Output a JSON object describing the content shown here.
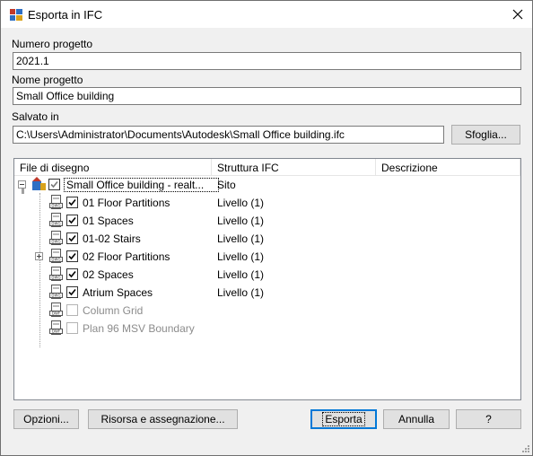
{
  "window": {
    "title": "Esporta in IFC"
  },
  "fields": {
    "project_number_label": "Numero progetto",
    "project_number_value": "2021.1",
    "project_name_label": "Nome progetto",
    "project_name_value": "Small Office building",
    "saved_in_label": "Salvato in",
    "saved_in_value": "C:\\Users\\Administrator\\Documents\\Autodesk\\Small Office building.ifc",
    "browse_label": "Sfoglia..."
  },
  "table": {
    "columns": [
      "File di disegno",
      "Struttura IFC",
      "Descrizione"
    ],
    "rows": [
      {
        "name": "Small Office building - realt...",
        "structure": "Sito",
        "enabled": true,
        "checked": true
      },
      {
        "name": "01 Floor Partitions",
        "structure": "Livello (1)",
        "enabled": true,
        "checked": true
      },
      {
        "name": "01 Spaces",
        "structure": "Livello (1)",
        "enabled": true,
        "checked": true
      },
      {
        "name": "01-02 Stairs",
        "structure": "Livello (1)",
        "enabled": true,
        "checked": true
      },
      {
        "name": "02 Floor Partitions",
        "structure": "Livello (1)",
        "enabled": true,
        "checked": true
      },
      {
        "name": "02 Spaces",
        "structure": "Livello (1)",
        "enabled": true,
        "checked": true
      },
      {
        "name": "Atrium Spaces",
        "structure": "Livello (1)",
        "enabled": true,
        "checked": true
      },
      {
        "name": "Column Grid",
        "structure": "",
        "enabled": false,
        "checked": false
      },
      {
        "name": "Plan 96 MSV Boundary",
        "structure": "",
        "enabled": false,
        "checked": false
      }
    ]
  },
  "footer": {
    "options_label": "Opzioni...",
    "resource_label": "Risorsa e assegnazione...",
    "export_label": "Esporta",
    "cancel_label": "Annulla",
    "help_label": "?"
  }
}
